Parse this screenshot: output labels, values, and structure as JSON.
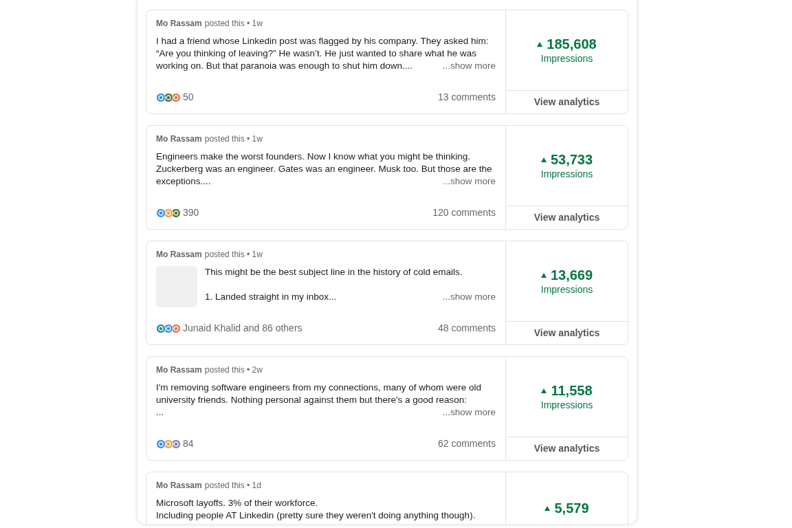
{
  "posts": [
    {
      "author": "Mo Rassam",
      "meta": "posted this • 1w",
      "lines": [
        "I had a friend whose Linkedin post was flagged by his company. They asked him:",
        "“Are you thinking of leaving?” He wasn’t. He just wanted to share what he was",
        "working on. But that paranoia was enough to shut him down...."
      ],
      "show_more": "...show more",
      "reactions": [
        {
          "kind": "like"
        },
        {
          "kind": "celebrate"
        },
        {
          "kind": "love"
        }
      ],
      "reaction_count": "50",
      "comments": "13 comments",
      "impressions": "185,608",
      "impressions_label": "Impressions",
      "analytics_button": "View analytics"
    },
    {
      "author": "Mo Rassam",
      "meta": "posted this • 1w",
      "lines": [
        "Engineers make the worst founders. Now I know what you might be thinking.",
        "Zuckerberg was an engineer. Gates was an engineer. Musk too. But those are the",
        "exceptions...."
      ],
      "show_more": "...show more",
      "reactions": [
        {
          "kind": "like"
        },
        {
          "kind": "insightful"
        },
        {
          "kind": "celebrate"
        }
      ],
      "reaction_count": "390",
      "comments": "120 comments",
      "impressions": "53,733",
      "impressions_label": "Impressions",
      "analytics_button": "View analytics"
    },
    {
      "author": "Mo Rassam",
      "meta": "posted this • 1w",
      "thumbnail": true,
      "lines": [
        "This might be the best subject line in the history of cold emails.",
        "1. Landed straight in my inbox..."
      ],
      "blank_line_before_last": true,
      "show_more": "...show more",
      "reactions": [
        {
          "kind": "funny"
        },
        {
          "kind": "like"
        },
        {
          "kind": "love"
        }
      ],
      "reaction_count": "Junaid Khalid and 86 others",
      "comments": "48 comments",
      "impressions": "13,669",
      "impressions_label": "Impressions",
      "analytics_button": "View analytics"
    },
    {
      "author": "Mo Rassam",
      "meta": "posted this • 2w",
      "lines": [
        "I'm removing software engineers from my connections, many of whom were old",
        "university friends. Nothing personal against them but there's a good reason:",
        "..."
      ],
      "show_more": "...show more",
      "reactions": [
        {
          "kind": "like"
        },
        {
          "kind": "insightful"
        },
        {
          "kind": "support"
        }
      ],
      "reaction_count": "84",
      "comments": "62 comments",
      "impressions": "11,558",
      "impressions_label": "Impressions",
      "analytics_button": "View analytics"
    },
    {
      "author": "Mo Rassam",
      "meta": "posted this • 1d",
      "lines": [
        "Microsoft layoffs. 3% of their workforce.",
        "Including people AT Linkedin (pretty sure they weren't doing anything though)."
      ],
      "impressions": "5,579"
    }
  ]
}
